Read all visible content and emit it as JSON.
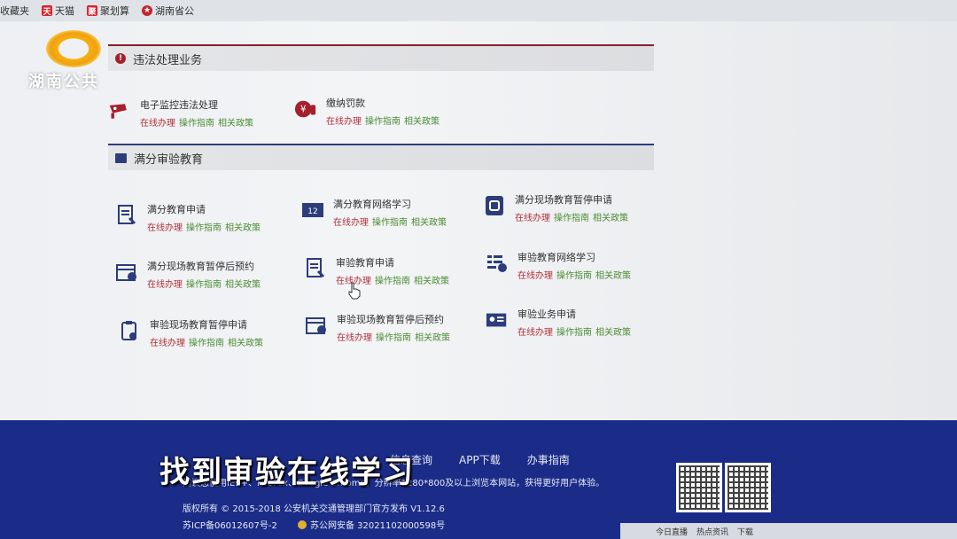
{
  "bookmarks": [
    {
      "label": "收藏夹",
      "icon": "star-icon",
      "color": "#e0a000"
    },
    {
      "label": "天猫",
      "icon": "tmall-icon",
      "color": "#d9232d"
    },
    {
      "label": "聚划算",
      "icon": "juhuasuan-icon",
      "color": "#d9232d"
    },
    {
      "label": "湖南省公",
      "icon": "emblem-icon",
      "color": "#c1272d"
    }
  ],
  "watermark": {
    "text": "湖南公共"
  },
  "sections": [
    {
      "title": "违法处理业务",
      "items": [
        {
          "title": "电子监控违法处理",
          "icon": "camera-icon"
        },
        {
          "title": "缴纳罚款",
          "icon": "fine-payment-icon"
        }
      ]
    },
    {
      "title": "满分审验教育",
      "items": [
        {
          "title": "满分教育申请",
          "icon": "document-edit-icon"
        },
        {
          "title": "满分教育网络学习",
          "icon": "online-study-icon"
        },
        {
          "title": "满分现场教育暂停申请",
          "icon": "pause-document-icon"
        },
        {
          "title": "满分现场教育暂停后预约",
          "icon": "calendar-icon"
        },
        {
          "title": "审验教育申请",
          "icon": "document-edit-icon"
        },
        {
          "title": "审验教育网络学习",
          "icon": "list-check-icon"
        },
        {
          "title": "审验现场教育暂停申请",
          "icon": "clipboard-icon"
        },
        {
          "title": "审验现场教育暂停后预约",
          "icon": "calendar-clock-icon"
        },
        {
          "title": "审验业务申请",
          "icon": "id-card-icon"
        }
      ]
    }
  ],
  "links": {
    "online": "在线办理",
    "guide": "操作指南",
    "policy": "相关政策"
  },
  "footer": {
    "nav": [
      "信息查询",
      "APP下载",
      "办事指南"
    ],
    "notice": "建议您使用IE9+、FireFox、Google Chrome，分辨率1280*800及以上浏览本网站，获得更好用户体验。",
    "copyright": "版权所有 © 2015-2018 公安机关交通管理部门官方发布 V1.12.6",
    "icp": "苏ICP备06012607号-2",
    "police": "苏公网安备 32021102000598号"
  },
  "subtitle": "找到审验在线学习",
  "taskbar": {
    "items": [
      "今日直播",
      "热点资讯",
      "下载"
    ]
  }
}
